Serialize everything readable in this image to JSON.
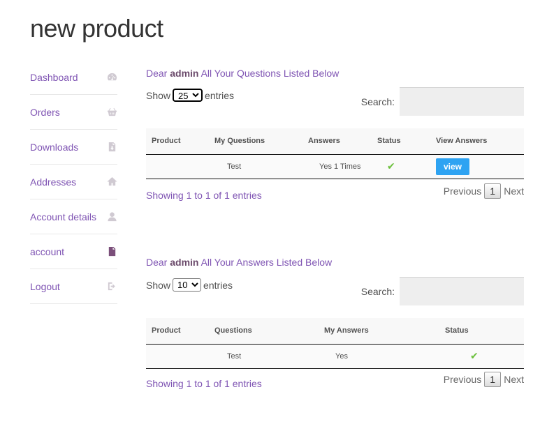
{
  "page": {
    "title": "new product"
  },
  "sidebar": {
    "items": [
      {
        "label": "Dashboard",
        "icon": "dashboard-icon"
      },
      {
        "label": "Orders",
        "icon": "basket-icon"
      },
      {
        "label": "Downloads",
        "icon": "file-download-icon"
      },
      {
        "label": "Addresses",
        "icon": "home-icon"
      },
      {
        "label": "Account details",
        "icon": "user-icon"
      },
      {
        "label": "account",
        "icon": "file-text-icon",
        "active": true
      },
      {
        "label": "Logout",
        "icon": "sign-out-icon"
      }
    ]
  },
  "questions": {
    "greeting_prefix": "Dear ",
    "user": "admin",
    "greeting_suffix": " All Your Questions Listed Below",
    "show_label": "Show",
    "entries_label": "entries",
    "length_value": "25",
    "search_label": "Search:",
    "search_value": "",
    "columns": [
      "Product",
      "My Questions",
      "Answers",
      "Status",
      "View Answers"
    ],
    "rows": [
      {
        "product": "",
        "question": "Test",
        "answers": "Yes 1 Times",
        "status": "✔",
        "action": "view"
      }
    ],
    "info": "Showing 1 to 1 of 1 entries",
    "pager": {
      "previous": "Previous",
      "page": "1",
      "next": "Next"
    }
  },
  "answers": {
    "greeting_prefix": "Dear ",
    "user": "admin",
    "greeting_suffix": " All Your Answers Listed Below",
    "show_label": "Show",
    "entries_label": "entries",
    "length_value": "10",
    "search_label": "Search:",
    "search_value": "",
    "columns": [
      "Product",
      "Questions",
      "My Answers",
      "Status"
    ],
    "rows": [
      {
        "product": "",
        "question": "Test",
        "answer": "Yes",
        "status": "✔"
      }
    ],
    "info": "Showing 1 to 1 of 1 entries",
    "pager": {
      "previous": "Previous",
      "page": "1",
      "next": "Next"
    }
  },
  "colors": {
    "link": "#7f54b3",
    "button": "#2ea3f2",
    "check": "#6abf3a"
  }
}
